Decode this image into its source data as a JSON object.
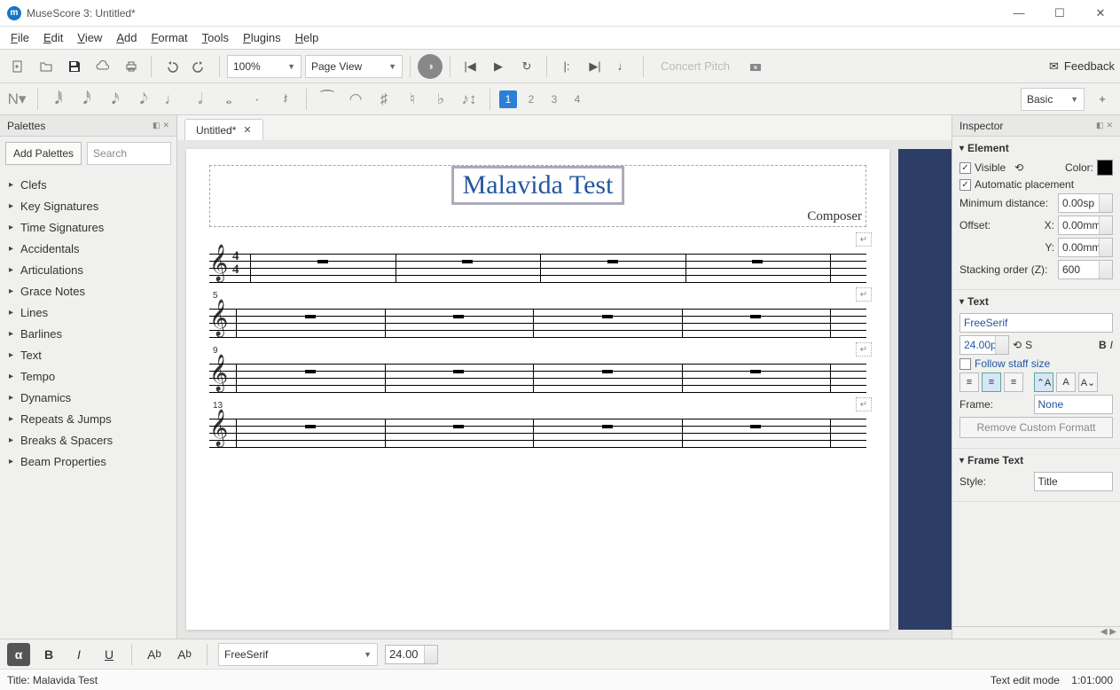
{
  "titlebar": {
    "title": "MuseScore 3: Untitled*"
  },
  "menu": [
    "File",
    "Edit",
    "View",
    "Add",
    "Format",
    "Tools",
    "Plugins",
    "Help"
  ],
  "toolbar1": {
    "zoom": "100%",
    "view_mode": "Page View",
    "concert_pitch": "Concert Pitch",
    "feedback": "Feedback"
  },
  "toolbar2": {
    "voices": [
      "1",
      "2",
      "3",
      "4"
    ],
    "workspace": "Basic"
  },
  "palettes": {
    "title": "Palettes",
    "add_btn": "Add Palettes",
    "search_placeholder": "Search",
    "items": [
      "Clefs",
      "Key Signatures",
      "Time Signatures",
      "Accidentals",
      "Articulations",
      "Grace Notes",
      "Lines",
      "Barlines",
      "Text",
      "Tempo",
      "Dynamics",
      "Repeats & Jumps",
      "Breaks & Spacers",
      "Beam Properties"
    ]
  },
  "tab": {
    "label": "Untitled*"
  },
  "score": {
    "title": "Malavida Test",
    "composer": "Composer",
    "timesig_top": "4",
    "timesig_bot": "4",
    "systems": [
      {
        "bar_num": ""
      },
      {
        "bar_num": "5"
      },
      {
        "bar_num": "9"
      },
      {
        "bar_num": "13"
      }
    ]
  },
  "inspector": {
    "title": "Inspector",
    "element": {
      "heading": "Element",
      "visible": "Visible",
      "color": "Color:",
      "auto_place": "Automatic placement",
      "min_dist_label": "Minimum distance:",
      "min_dist": "0.00sp",
      "offset": "Offset:",
      "x_label": "X:",
      "x": "0.00mm",
      "y_label": "Y:",
      "y": "0.00mm",
      "stack_label": "Stacking order (Z):",
      "stack": "600"
    },
    "text": {
      "heading": "Text",
      "font": "FreeSerif",
      "size": "24.00p",
      "s_label": "S",
      "b_label": "B",
      "i_label": "I",
      "follow": "Follow staff size",
      "frame_label": "Frame:",
      "frame_val": "None",
      "remove_btn": "Remove Custom Formatt"
    },
    "frame_text": {
      "heading": "Frame Text",
      "style_label": "Style:",
      "style_val": "Title"
    }
  },
  "bottom": {
    "font": "FreeSerif",
    "size": "24.00"
  },
  "status": {
    "left": "Title: Malavida Test",
    "mode": "Text edit mode",
    "pos": "1:01:000"
  }
}
